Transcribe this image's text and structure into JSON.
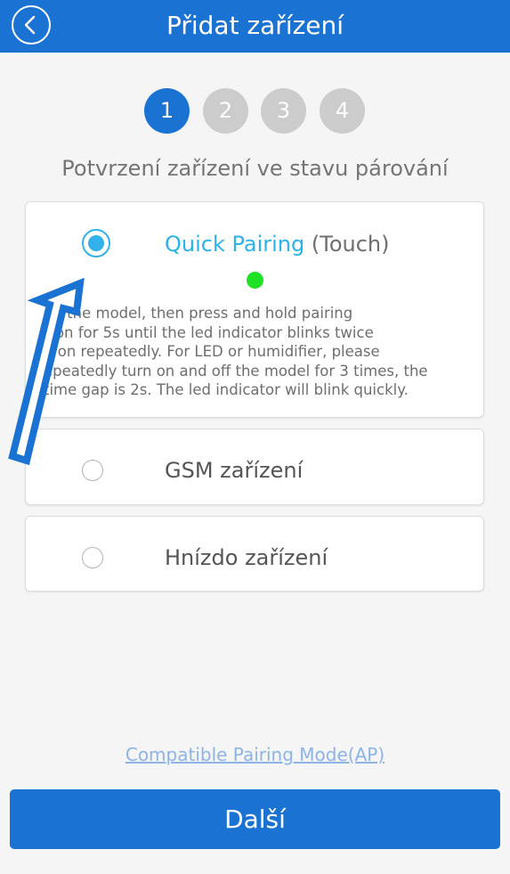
{
  "header": {
    "title": "Přidat zařízení",
    "back_icon": "chevron-left-icon"
  },
  "steps": [
    "1",
    "2",
    "3",
    "4"
  ],
  "active_step": 1,
  "subtitle": "Potvrzení zařízení ve stavu párování",
  "options": [
    {
      "label": "Quick Pairing",
      "label_suffix": "(Touch)",
      "selected": true,
      "indicator_color": "#1ee126",
      "description": "up the model, then press and hold pairing\ntton for 5s until the led indicator blinks twice\nd on repeatedly. For LED or humidifier, please\nepeatedly turn on and off the model for 3 times, the\ntime gap is 2s. The led indicator will blink quickly."
    },
    {
      "label": "GSM zařízení",
      "selected": false
    },
    {
      "label": "Hnízdo zařízení",
      "selected": false
    }
  ],
  "compatible_link": "Compatible Pairing Mode(AP)",
  "next_button": "Další",
  "colors": {
    "primary": "#1a73d3",
    "accent": "#33b1ea",
    "inactive_step": "#cccccc",
    "indicator": "#1ee126"
  }
}
